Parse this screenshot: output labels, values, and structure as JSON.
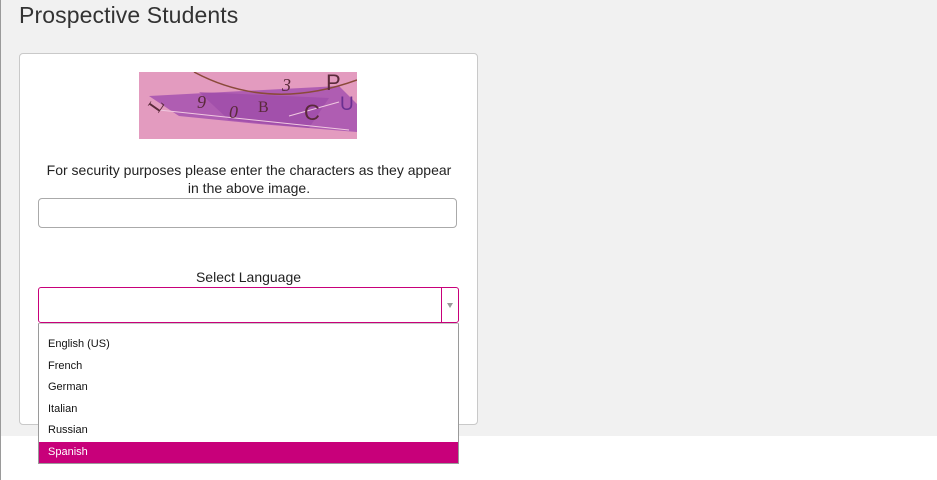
{
  "page": {
    "title": "Prospective Students"
  },
  "captcha": {
    "characters": [
      "L",
      "9",
      "0",
      "B",
      "3",
      "C",
      "P",
      "U"
    ],
    "instructions": "For security purposes please enter the characters as they appear in the above image.",
    "input_value": ""
  },
  "language": {
    "label": "Select Language",
    "selected_value": "",
    "options": [
      "English (US)",
      "French",
      "German",
      "Italian",
      "Russian",
      "Spanish"
    ],
    "highlighted_option": "Spanish"
  },
  "colors": {
    "accent": "#c8007a",
    "captcha_background": "#e39bbf",
    "captcha_band": "#a856b0",
    "page_background": "#f1f1f1"
  }
}
